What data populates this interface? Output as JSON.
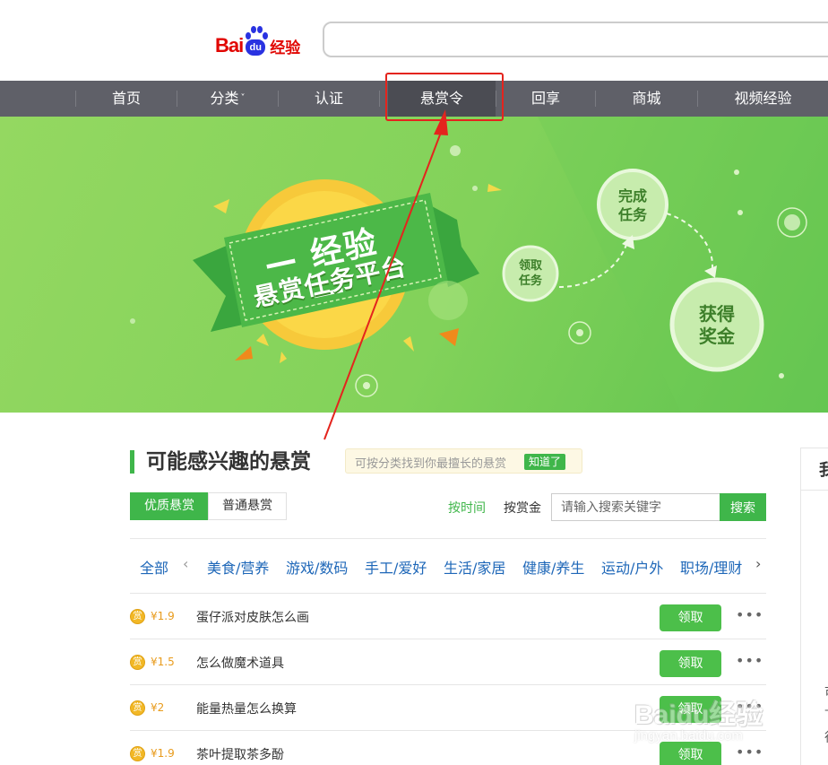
{
  "header": {
    "logo_bai": "Bai",
    "logo_du": "du",
    "logo_jingyan": "经验"
  },
  "nav": {
    "items": [
      {
        "label": "首页"
      },
      {
        "label": "分类",
        "caret": "˅"
      },
      {
        "label": "认证"
      },
      {
        "label": "悬赏令",
        "active": true
      },
      {
        "label": "回享"
      },
      {
        "label": "商城"
      },
      {
        "label": "视频经验"
      }
    ]
  },
  "banner": {
    "ribbon_line1": "— 经验 —",
    "ribbon_line2": "悬赏任务平台",
    "step_receive": "领取\n任务",
    "step_complete": "完成\n任务",
    "step_reward": "获得\n奖金"
  },
  "section": {
    "title": "可能感兴趣的悬赏",
    "tip": "可按分类找到你最擅长的悬赏",
    "tip_button": "知道了"
  },
  "tabs": {
    "quality": "优质悬赏",
    "normal": "普通悬赏"
  },
  "sort": {
    "by_time": "按时间",
    "by_bounty": "按赏金"
  },
  "search": {
    "placeholder": "请输入搜索关键字",
    "button": "搜索"
  },
  "categories": {
    "all": "全部",
    "left_arrow": "‹",
    "right_arrow": "›",
    "items": [
      "美食/营养",
      "游戏/数码",
      "手工/爱好",
      "生活/家居",
      "健康/养生",
      "运动/户外",
      "职场/理财"
    ]
  },
  "bounties": [
    {
      "coin": "赏",
      "price": "¥1.9",
      "title": "蛋仔派对皮肤怎么画",
      "action": "领取",
      "more": "•••"
    },
    {
      "coin": "赏",
      "price": "¥1.5",
      "title": "怎么做魔术道具",
      "action": "领取",
      "more": "•••"
    },
    {
      "coin": "赏",
      "price": "¥2",
      "title": "能量热量怎么换算",
      "action": "领取",
      "more": "•••"
    },
    {
      "coin": "赏",
      "price": "¥1.9",
      "title": "茶叶提取茶多酚",
      "action": "领取",
      "more": "•••"
    }
  ],
  "side": {
    "title": "我",
    "frag1": "可",
    "frag2": "—",
    "frag3": "行"
  },
  "watermark": {
    "big": "Baidu经验",
    "small": "jingyan.baidu.com"
  },
  "colors": {
    "accent_green": "#3fb64a",
    "nav_bg": "#5f6068",
    "highlight_red": "#e4241d",
    "link_blue": "#1e67b8",
    "price_orange": "#e89b1c"
  }
}
